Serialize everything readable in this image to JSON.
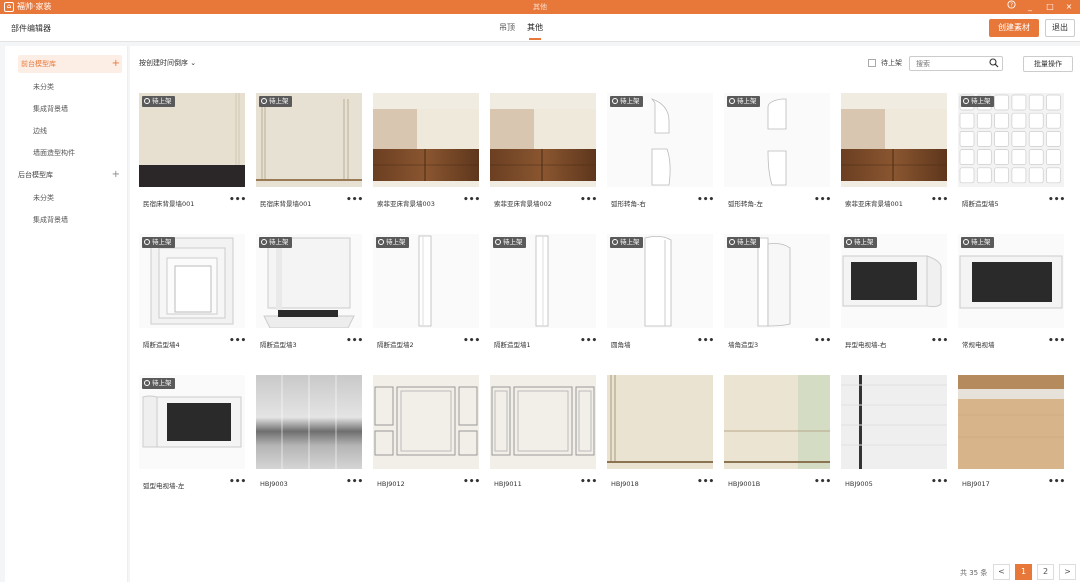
{
  "titlebar": {
    "app_title": "福帅·家装",
    "center_title": "其他",
    "help_icon": "help-circle-icon",
    "minimize": "_",
    "maximize": "□",
    "close": "×"
  },
  "header": {
    "editor_title": "部件编辑器",
    "tabs": [
      {
        "label": "吊顶",
        "active": false
      },
      {
        "label": "其他",
        "active": true
      }
    ],
    "create_button": "创建素材",
    "exit_button": "退出"
  },
  "sidebar": {
    "groups": [
      {
        "label": "前台模型库",
        "active": true,
        "add": "+",
        "children": [
          "未分类",
          "集成背景墙",
          "边线",
          "墙面造型构件"
        ]
      },
      {
        "label": "后台模型库",
        "active": false,
        "add": "+",
        "children": [
          "未分类",
          "集成背景墙"
        ]
      }
    ]
  },
  "toolbar": {
    "sort_label": "按创建时间倒序",
    "pending_label": "待上架",
    "search_placeholder": "搜索",
    "batch_button": "批量操作"
  },
  "badge_label": "待上架",
  "more_label": "•••",
  "items": [
    {
      "name": "民宿床背景墙001",
      "thumb": "panel-dark-bottom",
      "badge": true
    },
    {
      "name": "民宿床背景墙001",
      "thumb": "panel-lines",
      "badge": true
    },
    {
      "name": "索菲亚床背景墙003",
      "thumb": "wood-bottom-tile",
      "badge": false
    },
    {
      "name": "索菲亚床背景墙002",
      "thumb": "wood-bottom-tile",
      "badge": false
    },
    {
      "name": "弧形转角-右",
      "thumb": "curve-right",
      "badge": true
    },
    {
      "name": "弧形转角-左",
      "thumb": "curve-left",
      "badge": true
    },
    {
      "name": "索菲亚床背景墙001",
      "thumb": "wood-bottom-tile",
      "badge": false
    },
    {
      "name": "隔断造型墙5",
      "thumb": "grid-cubes",
      "badge": true
    },
    {
      "name": "隔断造型墙4",
      "thumb": "frame-nested",
      "badge": true
    },
    {
      "name": "隔断造型墙3",
      "thumb": "frame-floor",
      "badge": true
    },
    {
      "name": "隔断造型墙2",
      "thumb": "slim-column",
      "badge": true
    },
    {
      "name": "隔断造型墙1",
      "thumb": "slim-column-b",
      "badge": true
    },
    {
      "name": "圆角墙",
      "thumb": "round-column",
      "badge": true
    },
    {
      "name": "墙角造型3",
      "thumb": "corner-shape",
      "badge": true
    },
    {
      "name": "异型电视墙-右",
      "thumb": "tv-right",
      "badge": true
    },
    {
      "name": "常规电视墙",
      "thumb": "tv-regular",
      "badge": true
    },
    {
      "name": "弧型电视墙-左",
      "thumb": "tv-left",
      "badge": true
    },
    {
      "name": "HBJ9003",
      "thumb": "marble",
      "badge": false
    },
    {
      "name": "HBJ9012",
      "thumb": "panels-framed",
      "badge": false
    },
    {
      "name": "HBJ9011",
      "thumb": "panels-framed-b",
      "badge": false
    },
    {
      "name": "HBJ9018",
      "thumb": "beige-lines",
      "badge": false
    },
    {
      "name": "HBJ9001B",
      "thumb": "beige-green",
      "badge": false
    },
    {
      "name": "HBJ9005",
      "thumb": "white-stripe",
      "badge": false
    },
    {
      "name": "HBJ9017",
      "thumb": "wood-band",
      "badge": false
    }
  ],
  "pagination": {
    "total_label": "共 35 条",
    "prev": "<",
    "pages": [
      "1",
      "2"
    ],
    "active_page": "1",
    "next": ">"
  },
  "colors": {
    "accent": "#e8783a",
    "badge_bg": "#5a5a5a"
  }
}
